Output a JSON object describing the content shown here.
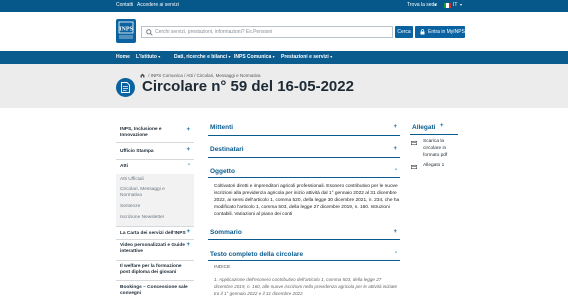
{
  "topbar": {
    "contatti": "Contatti",
    "accedere": "Accedere ai servizi",
    "trova_sede": "Trova la sede",
    "lang": "IT"
  },
  "header": {
    "logo_text": "INPS",
    "search_placeholder": "Cerchi servizi, prestazioni, informazioni? Es.Pensioni",
    "search_button": "Cerca",
    "login_button": "Entra in MyINPS"
  },
  "nav": {
    "items": [
      {
        "label": "Home"
      },
      {
        "label": "L'Istituto",
        "caret": "▾"
      },
      {
        "label": "Dati, ricerche e bilanci",
        "caret": "▾"
      },
      {
        "label": "INPS Comunica",
        "caret": "▾"
      },
      {
        "label": "Prestazioni e servizi",
        "caret": "▾"
      }
    ]
  },
  "breadcrumb": [
    "INPS Comunica",
    "Atti",
    "Circolari, Messaggi e Normativa"
  ],
  "breadcrumb_sep": "/",
  "page_title": "Circolare n° 59 del 16-05-2022",
  "sidebar": {
    "items": [
      {
        "label_lines": [
          "INPS, Inclusione e",
          "Innovazione"
        ],
        "plus": "+"
      },
      {
        "label_lines": [
          "Ufficio Stampa"
        ],
        "plus": "+"
      },
      {
        "label_lines": [
          "Atti"
        ],
        "plus": "-"
      },
      {
        "label_lines": [
          "La Carta dei servizi dell'INPS"
        ],
        "plus": "+"
      },
      {
        "label_lines": [
          "Video personalizzati e Guide",
          "interattive"
        ],
        "plus": "+"
      },
      {
        "label_lines": [
          "Il welfare per la formazione",
          "post diploma dei giovani"
        ],
        "plus": ""
      },
      {
        "label_lines": [
          "Bookings – Concessione sale",
          "convegni"
        ],
        "plus": ""
      }
    ],
    "atti_sub": [
      {
        "lines": [
          "Atti Ufficiali"
        ]
      },
      {
        "lines": [
          "Circolari, Messaggi e",
          "Normativa"
        ]
      },
      {
        "lines": [
          "Sentenze"
        ]
      },
      {
        "lines": [
          "Iscrizione Newsletter"
        ]
      }
    ]
  },
  "main": {
    "sections": [
      {
        "title": "Mittenti",
        "plus": "+"
      },
      {
        "title": "Destinatari",
        "plus": "+"
      },
      {
        "title": "Oggetto",
        "plus": "-"
      },
      {
        "title": "Sommario",
        "plus": "+"
      },
      {
        "title": "Testo completo della circolare",
        "plus": "-"
      }
    ],
    "oggetto_text": "Coltivatori diretti e imprenditori agricoli professionali. Esonero contributivo per le nuove iscrizioni alla previdenza agricola per inizio attività dal 1° gennaio 2022 al 31 dicembre 2022, ai sensi dell'articolo 1, comma 520, della legge 30 dicembre 2021, n. 234, che ha modificato l'articolo 1, comma 503, della legge 27 dicembre 2019, n. 160. Istruzioni contabili. Variazioni al piano dei conti",
    "indice_label": "INDICE",
    "indice_text": "1. Applicazione dell'esonero contributivo dell'articolo 1, comma 503, della legge 27 dicembre 2019, n. 160, alle nuove iscrizioni nella previdenza agricola per le attività iniziate tra il 1° gennaio 2022 e il 31 dicembre 2022"
  },
  "allegati": {
    "title": "Allegati",
    "plus": "+",
    "items": [
      {
        "lines": [
          "Scarica la",
          "circolare in",
          "formato pdf"
        ]
      },
      {
        "lines": [
          "Allegato 1"
        ]
      }
    ]
  },
  "colors": {
    "brand": "#0a63a0",
    "nav": "#0a5c8f",
    "banner": "#ececec"
  },
  "icons": [
    "search-icon",
    "lock-icon",
    "home-icon",
    "document-icon",
    "pdf-icon",
    "flag-icon"
  ]
}
